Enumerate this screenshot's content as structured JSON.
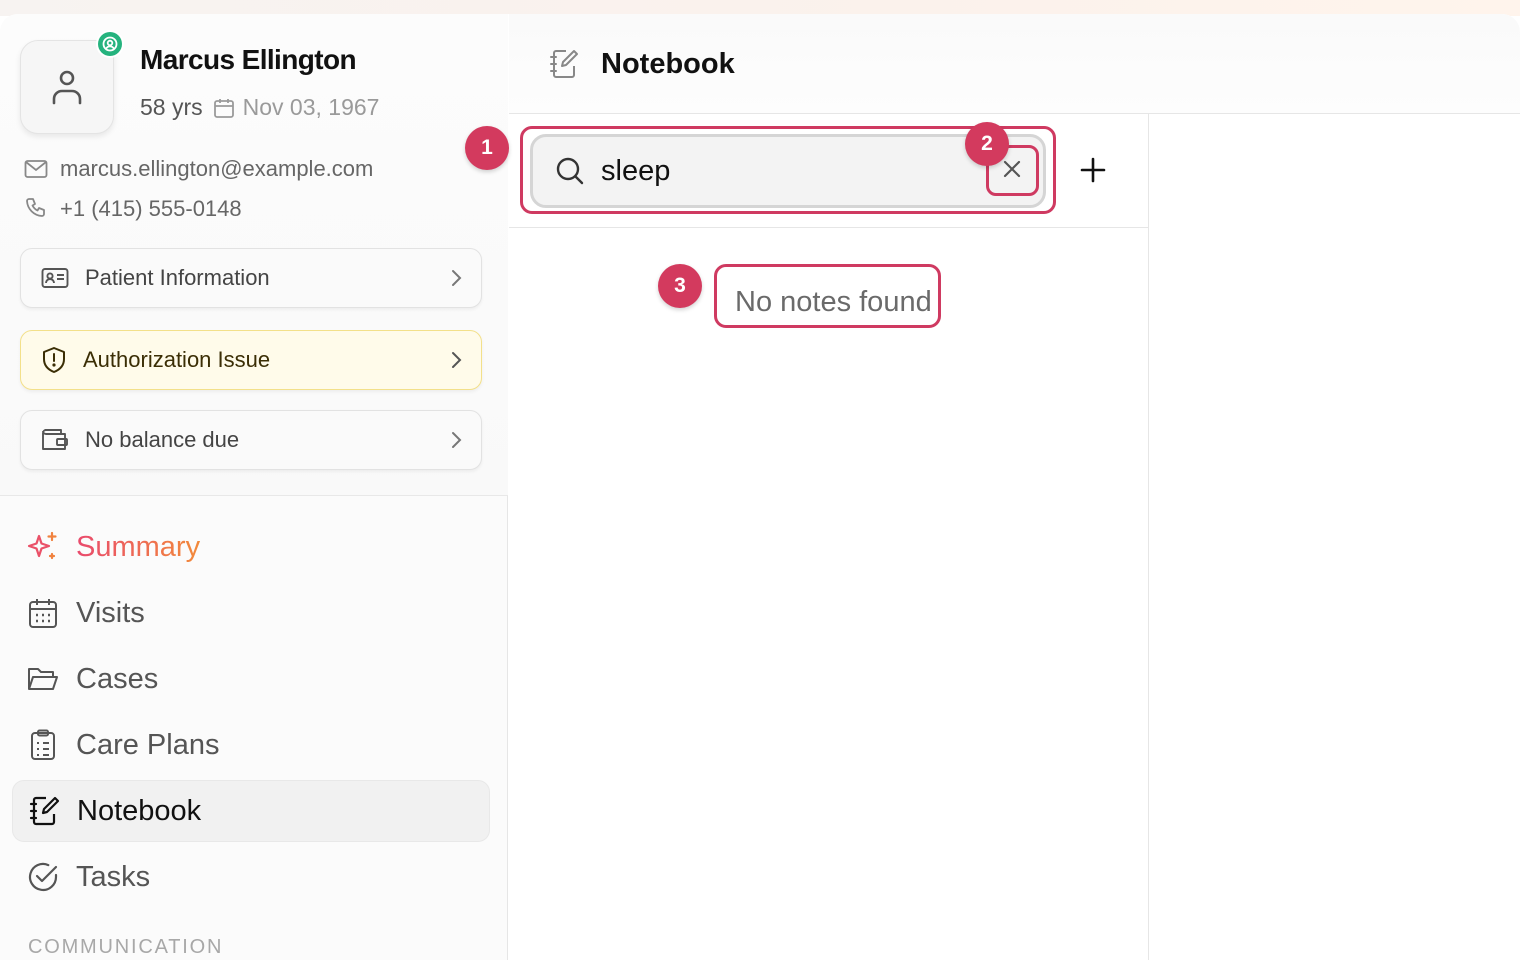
{
  "patient": {
    "name": "Marcus Ellington",
    "age": "58 yrs",
    "dob": "Nov 03, 1967",
    "email": "marcus.ellington@example.com",
    "phone": "+1 (415) 555-0148",
    "status_icon": "user-circle-icon",
    "status_color": "#25b37e"
  },
  "cards": {
    "patient_info": "Patient Information",
    "authorization": "Authorization Issue",
    "balance": "No balance due"
  },
  "nav": {
    "summary": "Summary",
    "visits": "Visits",
    "cases": "Cases",
    "care_plans": "Care Plans",
    "notebook": "Notebook",
    "tasks": "Tasks",
    "section_communication": "COMMUNICATION"
  },
  "main": {
    "title": "Notebook",
    "search_value": "sleep",
    "empty_text": "No notes found"
  },
  "annotations": {
    "markers": [
      "1",
      "2",
      "3"
    ],
    "color": "#cf3a61"
  },
  "colors": {
    "summary_gradient_start": "#e94a6d",
    "summary_gradient_end": "#f28a3a",
    "warning_bg": "#fffbea",
    "warning_border": "#f3e08a"
  }
}
